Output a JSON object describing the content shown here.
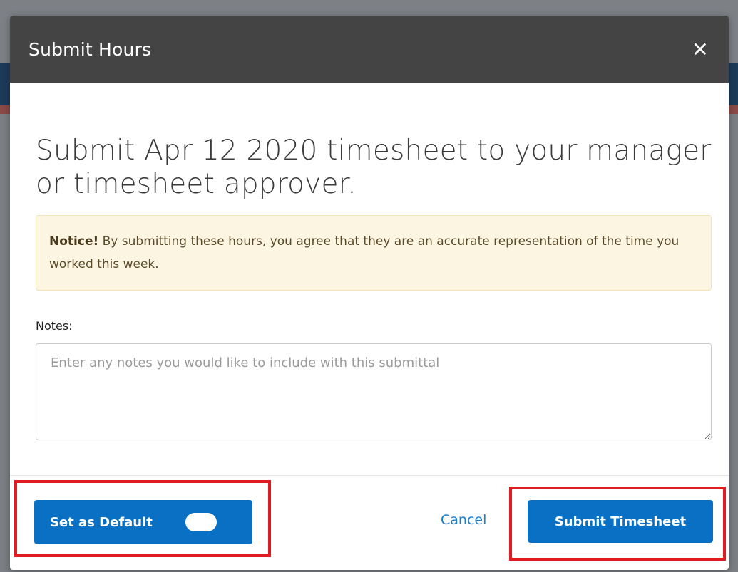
{
  "modal": {
    "title": "Submit Hours",
    "close_label": "✕"
  },
  "headline": {
    "prefix": "Submit ",
    "date": "Apr 12 2020",
    "suffix": " timesheet to your manager or timesheet approver."
  },
  "notice": {
    "label": "Notice!",
    "text": " By submitting these hours, you agree that they are an accurate representation of the time you worked this week."
  },
  "notes": {
    "label": "Notes:",
    "placeholder": "Enter any notes you would like to include with this submittal",
    "value": ""
  },
  "footer": {
    "default_label": "Set as Default",
    "toggle_state": "off",
    "cancel_label": "Cancel",
    "submit_label": "Submit Timesheet"
  },
  "colors": {
    "header_bg": "#444444",
    "primary": "#0a70c4",
    "link": "#1a7fd4",
    "notice_bg": "#fcf5e2",
    "highlight": "#e11b22"
  }
}
